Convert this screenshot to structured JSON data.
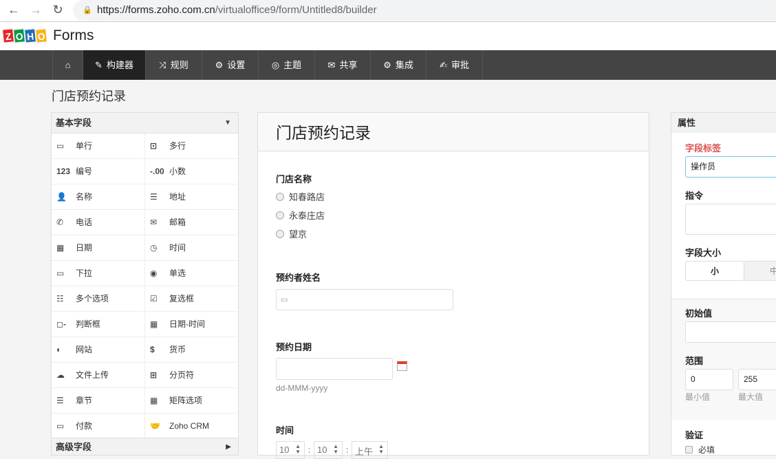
{
  "browser": {
    "url_host": "https://forms.zoho.com.cn",
    "url_path": "/virtualoffice9/form/Untitled8/builder",
    "back": "←",
    "forward": "→",
    "reload": "↻"
  },
  "logo": {
    "letters": [
      "Z",
      "O",
      "H",
      "O"
    ],
    "product": "Forms"
  },
  "nav": [
    {
      "label": "",
      "icon": "home"
    },
    {
      "label": "构建器",
      "icon": "builder",
      "active": true
    },
    {
      "label": "规则",
      "icon": "shuffle"
    },
    {
      "label": "设置",
      "icon": "settings"
    },
    {
      "label": "主题",
      "icon": "palette"
    },
    {
      "label": "共享",
      "icon": "share"
    },
    {
      "label": "集成",
      "icon": "gears"
    },
    {
      "label": "审批",
      "icon": "edit"
    }
  ],
  "page_title": "门店预约记录",
  "fields_panel": {
    "header": "基本字段",
    "advanced": "高级字段",
    "items": [
      {
        "label": "单行",
        "icon": "▭"
      },
      {
        "label": "多行",
        "icon": "⊡"
      },
      {
        "label": "编号",
        "icon": "123"
      },
      {
        "label": "小数",
        "icon": "-.00"
      },
      {
        "label": "名称",
        "icon": "👤"
      },
      {
        "label": "地址",
        "icon": "☰"
      },
      {
        "label": "电话",
        "icon": "✆"
      },
      {
        "label": "邮箱",
        "icon": "✉"
      },
      {
        "label": "日期",
        "icon": "▦"
      },
      {
        "label": "时间",
        "icon": "◷"
      },
      {
        "label": "下拉",
        "icon": "▭"
      },
      {
        "label": "单选",
        "icon": "◉"
      },
      {
        "label": "多个选项",
        "icon": "☷"
      },
      {
        "label": "复选框",
        "icon": "☑"
      },
      {
        "label": "判断框",
        "icon": "◻-"
      },
      {
        "label": "日期-时间",
        "icon": "▦"
      },
      {
        "label": "网站",
        "icon": "◐"
      },
      {
        "label": "货币",
        "icon": "$"
      },
      {
        "label": "文件上传",
        "icon": "☁"
      },
      {
        "label": "分页符",
        "icon": "⊞"
      },
      {
        "label": "章节",
        "icon": "☰"
      },
      {
        "label": "矩阵选项",
        "icon": "▦"
      },
      {
        "label": "付款",
        "icon": "▭"
      },
      {
        "label": "Zoho CRM",
        "icon": "🤝"
      }
    ]
  },
  "form": {
    "title": "门店预约记录",
    "store": {
      "label": "门店名称",
      "options": [
        "知春路店",
        "永泰庄店",
        "望京"
      ]
    },
    "name": {
      "label": "预约者姓名"
    },
    "date": {
      "label": "预约日期",
      "hint": "dd-MMM-yyyy"
    },
    "time": {
      "label": "时间",
      "hour": "10",
      "minute": "10",
      "ampm": "上午"
    }
  },
  "props": {
    "header": "属性",
    "field_label": "字段标签",
    "field_label_value": "操作员",
    "instruction": "指令",
    "size": "字段大小",
    "size_small": "小",
    "size_medium": "中等",
    "initial": "初始值",
    "range": "范围",
    "min": "0",
    "max": "255",
    "min_label": "最小值",
    "max_label": "最大值",
    "validation": "验证",
    "required": "必填"
  },
  "colors": {
    "accent": "#d9534f",
    "nav": "#444444",
    "nav_active": "#222222"
  }
}
